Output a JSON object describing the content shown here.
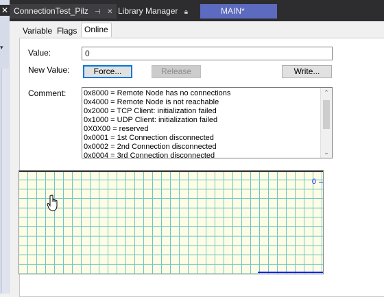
{
  "document_tabs": [
    {
      "label": "ConnectionTest_Pilz",
      "pin_icon": "pin-icon",
      "close_icon": "close-icon"
    },
    {
      "label": "Library Manager",
      "lock_icon": "lock-icon"
    },
    {
      "label": "MAIN*"
    }
  ],
  "left_close": "✕",
  "inner_tabs": [
    "Variable",
    "Flags",
    "Online"
  ],
  "form": {
    "value_label": "Value:",
    "value": "0",
    "new_value_label": "New Value:",
    "force_button": "Force...",
    "release_button": "Release",
    "write_button": "Write...",
    "comment_label": "Comment:"
  },
  "comment_lines": [
    "0x8000 = Remote Node has no connections",
    "0x4000 = Remote Node is not reachable",
    "0x2000 = TCP Client: initialization failed",
    "0x1000 = UDP Client: initialization failed",
    "0X0X00 = reserved",
    "0x0001 = 1st Connection disconnected",
    "0x0002 = 2nd Connection disconnected",
    "0x0004 = 3rd Connection disconnected"
  ],
  "chart": {
    "zero_label": "0",
    "colors": {
      "grid": "#6fc5c5",
      "background": "#fdfde6",
      "trace": "#1a1aff"
    }
  }
}
